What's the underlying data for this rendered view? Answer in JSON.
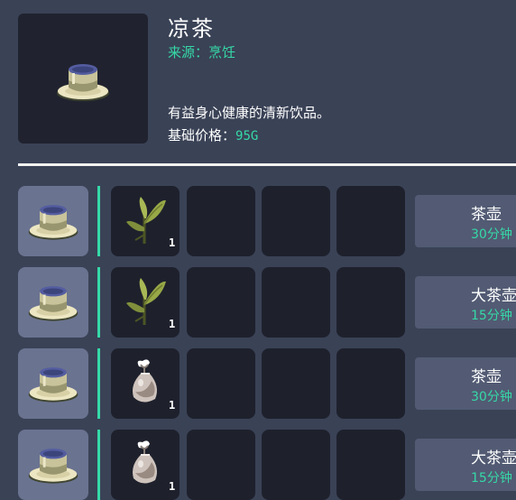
{
  "item": {
    "name": "凉茶",
    "source": "来源：烹饪",
    "description": "有益身心健康的清新饮品。",
    "price_label": "基础价格：",
    "price_value": "95G",
    "icon": "cold-tea-cup-icon"
  },
  "recipes": [
    {
      "product_icon": "cold-tea-cup-icon",
      "ingredients": [
        {
          "icon": "tea-leaf-icon",
          "count": "1"
        }
      ],
      "empty_slots": 3,
      "tool": "茶壶",
      "time": "30分钟"
    },
    {
      "product_icon": "cold-tea-cup-icon",
      "ingredients": [
        {
          "icon": "tea-leaf-icon",
          "count": "1"
        }
      ],
      "empty_slots": 3,
      "tool": "大茶壶",
      "time": "15分钟"
    },
    {
      "product_icon": "cold-tea-cup-icon",
      "ingredients": [
        {
          "icon": "tea-bag-icon",
          "count": "1"
        }
      ],
      "empty_slots": 3,
      "tool": "茶壶",
      "time": "30分钟"
    },
    {
      "product_icon": "cold-tea-cup-icon",
      "ingredients": [
        {
          "icon": "tea-bag-icon",
          "count": "1"
        }
      ],
      "empty_slots": 3,
      "tool": "大茶壶",
      "time": "15分钟"
    }
  ],
  "colors": {
    "background": "#3a4256",
    "accent": "#35d9a7",
    "slot_dark": "#1e212c",
    "slot_light": "#6a7390",
    "tool_box": "#525b73"
  }
}
